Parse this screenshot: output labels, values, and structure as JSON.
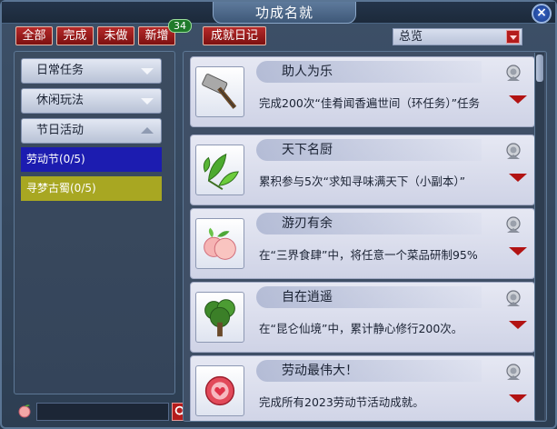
{
  "window": {
    "title": "功成名就",
    "close_label": "×"
  },
  "filters": [
    {
      "label": "全部"
    },
    {
      "label": "完成"
    },
    {
      "label": "未做"
    },
    {
      "label": "新增"
    },
    {
      "label": "成就日记"
    }
  ],
  "new_badge": "34",
  "view_select": {
    "selected": "总览"
  },
  "categories": [
    {
      "label": "日常任务",
      "expanded": false
    },
    {
      "label": "休闲玩法",
      "expanded": false
    },
    {
      "label": "节日活动",
      "expanded": true
    }
  ],
  "subcategories": [
    {
      "label": "劳动节(0/5)",
      "selected": true,
      "color": "#1c1cb0"
    },
    {
      "label": "寻梦古蜀(0/5)",
      "selected": false,
      "color": "#a8a722"
    }
  ],
  "achievements": [
    {
      "name": "助人为乐",
      "desc": "完成200次“佳肴闻香遍世间（环任务）”任务",
      "icon": "hammer-icon"
    },
    {
      "name": "天下名厨",
      "desc": "累积参与5次“求知寻味满天下（小副本）”",
      "icon": "leaf-icon"
    },
    {
      "name": "游刃有余",
      "desc": "在“三界食肆”中，将任意一个菜品研制95%",
      "icon": "peach-icon"
    },
    {
      "name": "自在逍遥",
      "desc": "在“昆仑仙境”中，累计静心修行200次。",
      "icon": "tree-icon"
    },
    {
      "name": "劳动最伟大！",
      "desc": "完成所有2023劳动节活动成就。",
      "icon": "gem-icon"
    }
  ],
  "colors": {
    "button_red": "#b52a2a",
    "selected_blue": "#1c1cb0",
    "selected_olive": "#a8a722",
    "arrow_red": "#b21313"
  }
}
